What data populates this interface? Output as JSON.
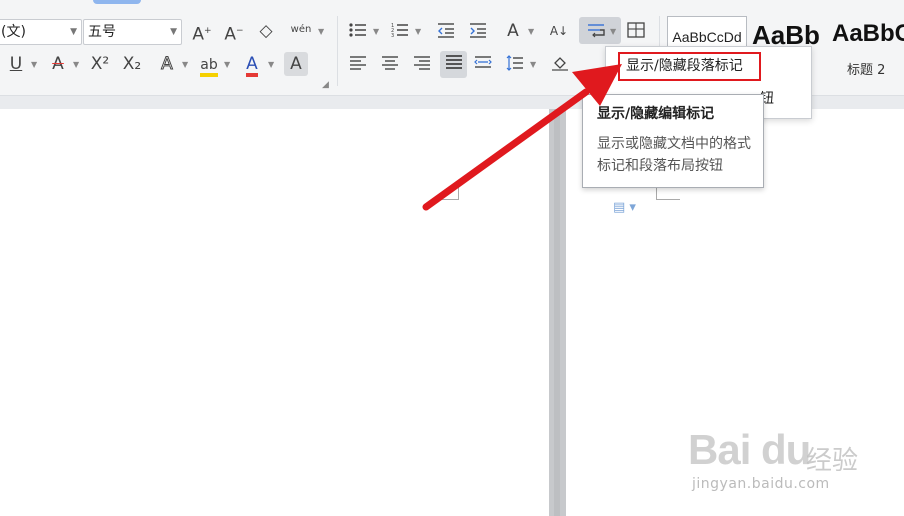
{
  "ribbon": {
    "font_name_value": "(文)",
    "font_size_value": "五号",
    "style_normal_sample": "AaBbCcDd",
    "style_heading1_sample": "AaBb",
    "style_heading2_sample": "AaBbC",
    "style_heading2_label": "标题 2",
    "pinyin_glyph": "wén",
    "font_color_glyph": "A",
    "char_shading_glyph": "A",
    "highlight_glyph": "ab",
    "text_effect_glyph": "A",
    "grow_font_glyph": "A",
    "shrink_font_glyph": "A",
    "clear_format_glyph": "◇",
    "underline_glyph": "U",
    "strike_glyph": "A",
    "superscript_glyph": "X²",
    "subscript_glyph": "X₂",
    "sort_glyph": "A↓",
    "text_direction_glyph": "A"
  },
  "menu": {
    "item_show_hide_paragraph": "显示/隐藏段落标记",
    "item2_tail": "钮"
  },
  "tooltip": {
    "title": "显示/隐藏编辑标记",
    "description": "显示或隐藏文档中的格式标记和段落布局按钮"
  },
  "watermark": {
    "logo": "Bai du",
    "text": "经验",
    "url": "jingyan.baidu.com"
  },
  "colors": {
    "highlight_red": "#e0191e",
    "font_color_red": "#e53935",
    "highlight_yellow": "#f5d000",
    "ribbon_bg": "#f4f5f6",
    "gutter": "#c7c9cc"
  }
}
